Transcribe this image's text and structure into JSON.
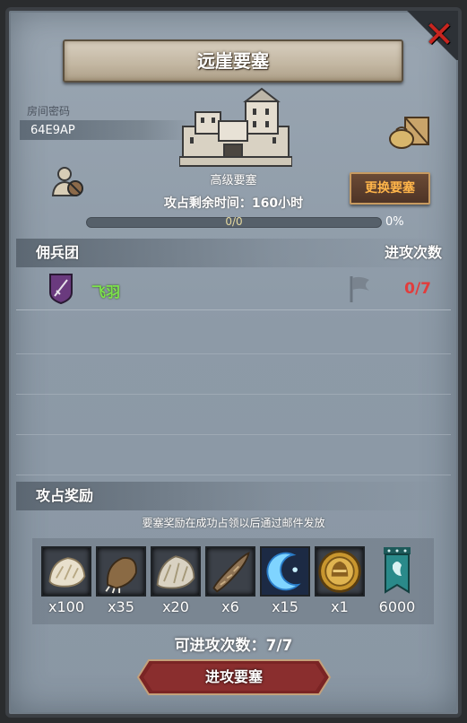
{
  "header": {
    "title": "远崖要塞",
    "close_icon": "close-x-icon"
  },
  "room": {
    "label": "房间密码",
    "code": "64E9AP"
  },
  "fortress": {
    "grade": "高级要塞",
    "change_button": "更换要塞",
    "time_label": "攻占剩余时间：",
    "time_value": "160",
    "time_unit": "小时",
    "progress_text": "0/0",
    "progress_percent": "0%",
    "progress_fraction": 0
  },
  "mercenary": {
    "section_title": "佣兵团",
    "count_header": "进攻次数",
    "rows": [
      {
        "name": "飞羽",
        "attacks": "0/7",
        "icon": "crossed-sword-shield-icon",
        "flag_icon": "flag-icon"
      }
    ]
  },
  "rewards": {
    "section_title": "攻占奖励",
    "note": "要塞奖励在成功占领以后通过邮件发放",
    "items": [
      {
        "icon": "white-fur-icon",
        "qty": "x100"
      },
      {
        "icon": "claw-paw-icon",
        "qty": "x35"
      },
      {
        "icon": "grey-fur-icon",
        "qty": "x20"
      },
      {
        "icon": "horn-icon",
        "qty": "x6"
      },
      {
        "icon": "blue-crescent-icon",
        "qty": "x15"
      },
      {
        "icon": "golden-helmet-medal-icon",
        "qty": "x1"
      },
      {
        "icon": "guild-banner-icon",
        "qty": "6000"
      }
    ]
  },
  "footer": {
    "attempts_label": "可进攻次数：",
    "attempts_value": "7/7",
    "attack_button": "进攻要塞"
  },
  "colors": {
    "panel_bg": "#9aa6b2",
    "title_parchment": "#c2b6a1",
    "change_button_text": "#ffb54a",
    "mercenary_name": "#7de24c",
    "attack_count_red": "#e23c3c",
    "attack_button_red": "#8a2a2a"
  }
}
